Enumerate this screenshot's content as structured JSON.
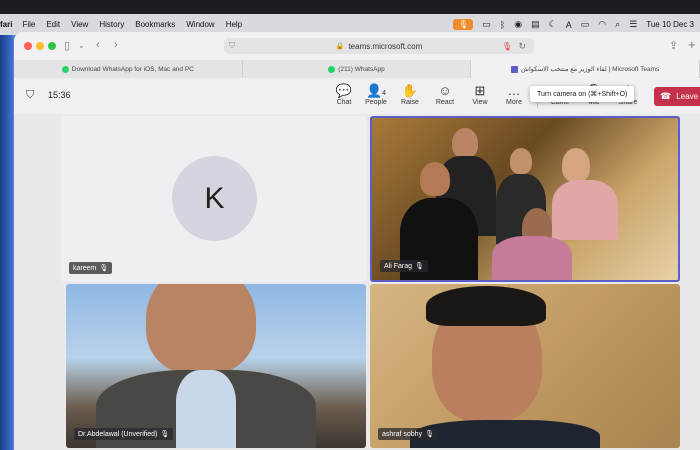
{
  "menubar": {
    "app_name": "fari",
    "items": [
      "File",
      "Edit",
      "View",
      "History",
      "Bookmarks",
      "Window",
      "Help"
    ],
    "clock": "Tue 10 Dec 3"
  },
  "browser": {
    "address": "teams.microsoft.com",
    "tabs": [
      {
        "label": "Download WhatsApp for iOS, Mac and PC",
        "active": false
      },
      {
        "label": "(211) WhatsApp",
        "active": false
      },
      {
        "label": "لقاء الوزير مع منتخب الاسكواش | Microsoft Teams",
        "active": true
      }
    ]
  },
  "teams": {
    "timer": "15:36",
    "controls": {
      "chat": "Chat",
      "people": "People",
      "people_count": "4",
      "raise": "Raise",
      "react": "React",
      "view": "View",
      "more": "More",
      "camera": "Came",
      "mic": "Mic",
      "share": "Share",
      "leave": "Leave"
    },
    "tooltip": "Turn camera on (⌘+Shift+O)",
    "participants": [
      {
        "name": "kareem",
        "initial": "K"
      },
      {
        "name": "Ali Farag"
      },
      {
        "name": "Dr.Abdelawal (Unverified)"
      },
      {
        "name": "ashraf sobhy"
      }
    ]
  },
  "colors": {
    "accent": "#5b5fc7",
    "leave": "#c4314b",
    "mic_pill": "#f08a2a"
  }
}
